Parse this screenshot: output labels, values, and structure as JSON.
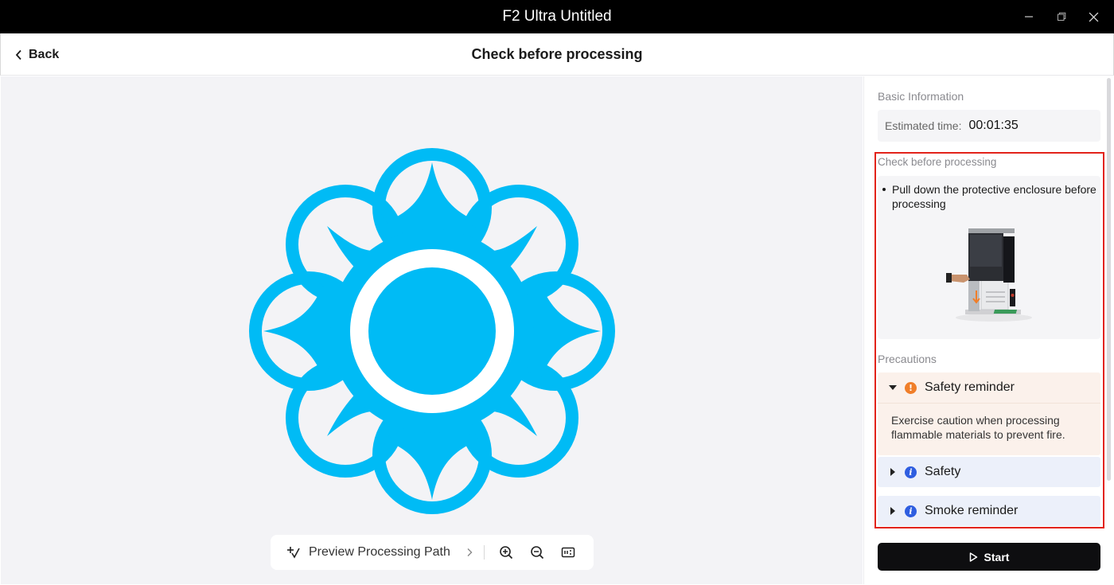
{
  "window": {
    "title": "F2 Ultra Untitled"
  },
  "header": {
    "back_label": "Back",
    "title": "Check before processing"
  },
  "toolbar": {
    "preview_label": "Preview Processing Path",
    "icons": [
      "preview-path-icon",
      "chevron-right-icon",
      "zoom-in-icon",
      "zoom-out-icon",
      "fit-to-screen-icon"
    ]
  },
  "design": {
    "color": "#00bbf5",
    "icon": "flower-mandala-design"
  },
  "panel": {
    "basic_info_label": "Basic Information",
    "estimated_time_label": "Estimated time:",
    "estimated_time_value": "00:01:35",
    "check_label": "Check before processing",
    "check_items": [
      "Pull down the protective enclosure before processing"
    ],
    "precautions_label": "Precautions",
    "precautions": [
      {
        "title": "Safety reminder",
        "level": "warning",
        "expanded": true,
        "body": "Exercise caution when processing flammable materials to prevent fire."
      },
      {
        "title": "Safety",
        "level": "info",
        "expanded": false
      },
      {
        "title": "Smoke reminder",
        "level": "info",
        "expanded": false
      }
    ],
    "start_label": "Start"
  },
  "colors": {
    "accent_highlight": "#e2231a",
    "warning": "#f07e29",
    "info": "#2f5ee0",
    "primary_button": "#0e0e10"
  }
}
